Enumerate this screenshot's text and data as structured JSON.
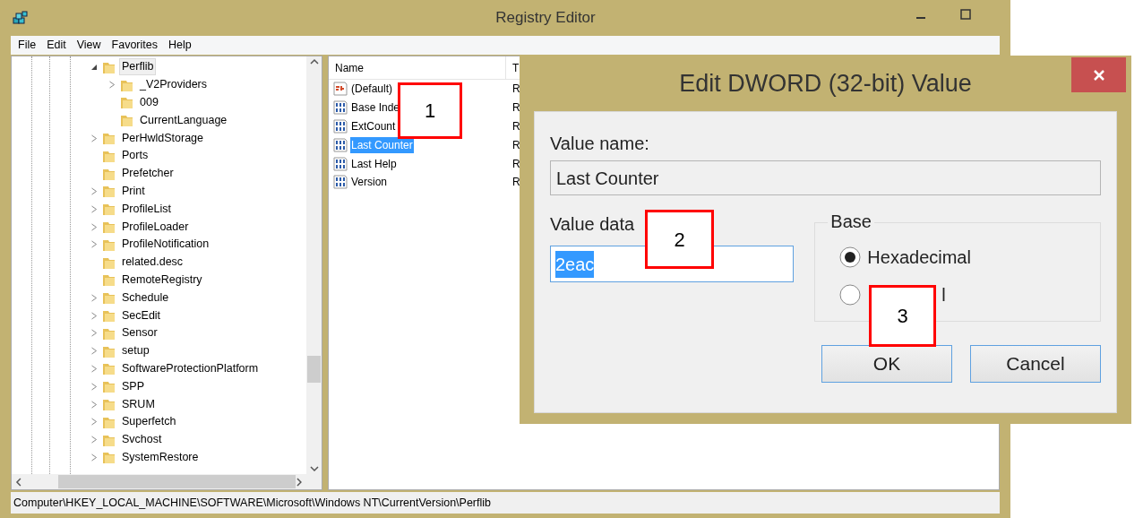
{
  "window": {
    "title": "Registry Editor"
  },
  "menu": [
    "File",
    "Edit",
    "View",
    "Favorites",
    "Help"
  ],
  "tree": {
    "items": [
      {
        "label": "Perflib",
        "kind": "branch",
        "expanded": true,
        "selected": true,
        "children": [
          {
            "label": "_V2Providers",
            "kind": "branch",
            "expanded": false,
            "selected": false
          },
          {
            "label": "009",
            "kind": "leaf",
            "selected": false
          },
          {
            "label": "CurrentLanguage",
            "kind": "leaf",
            "selected": false
          }
        ]
      },
      {
        "label": "PerHwldStorage",
        "kind": "branch",
        "expanded": false,
        "selected": false
      },
      {
        "label": "Ports",
        "kind": "leaf",
        "selected": false
      },
      {
        "label": "Prefetcher",
        "kind": "leaf",
        "selected": false
      },
      {
        "label": "Print",
        "kind": "branch",
        "expanded": false,
        "selected": false
      },
      {
        "label": "ProfileList",
        "kind": "branch",
        "expanded": false,
        "selected": false
      },
      {
        "label": "ProfileLoader",
        "kind": "branch",
        "expanded": false,
        "selected": false
      },
      {
        "label": "ProfileNotification",
        "kind": "branch",
        "expanded": false,
        "selected": false
      },
      {
        "label": "related.desc",
        "kind": "leaf",
        "selected": false
      },
      {
        "label": "RemoteRegistry",
        "kind": "leaf",
        "selected": false
      },
      {
        "label": "Schedule",
        "kind": "branch",
        "expanded": false,
        "selected": false
      },
      {
        "label": "SecEdit",
        "kind": "branch",
        "expanded": false,
        "selected": false
      },
      {
        "label": "Sensor",
        "kind": "branch",
        "expanded": false,
        "selected": false
      },
      {
        "label": "setup",
        "kind": "branch",
        "expanded": false,
        "selected": false
      },
      {
        "label": "SoftwareProtectionPlatform",
        "kind": "branch",
        "expanded": false,
        "selected": false
      },
      {
        "label": "SPP",
        "kind": "branch",
        "expanded": false,
        "selected": false
      },
      {
        "label": "SRUM",
        "kind": "branch",
        "expanded": false,
        "selected": false
      },
      {
        "label": "Superfetch",
        "kind": "branch",
        "expanded": false,
        "selected": false
      },
      {
        "label": "Svchost",
        "kind": "branch",
        "expanded": false,
        "selected": false
      },
      {
        "label": "SystemRestore",
        "kind": "branch",
        "expanded": false,
        "selected": false
      }
    ]
  },
  "values": {
    "columns": [
      "Name",
      "T"
    ],
    "rows": [
      {
        "name": "(Default)",
        "column_2": "R",
        "kind": "string",
        "selected": false
      },
      {
        "name": "Base Inde",
        "column_2": "R",
        "kind": "dword",
        "selected": false
      },
      {
        "name": "ExtCount",
        "column_2": "R",
        "kind": "dword",
        "selected": false
      },
      {
        "name": "Last Counter",
        "column_2": "R",
        "kind": "dword",
        "selected": true
      },
      {
        "name": "Last Help",
        "column_2": "R",
        "kind": "dword",
        "selected": false
      },
      {
        "name": "Version",
        "column_2": "R",
        "kind": "dword",
        "selected": false
      }
    ]
  },
  "status_bar": "Computer\\HKEY_LOCAL_MACHINE\\SOFTWARE\\Microsoft\\Windows NT\\CurrentVersion\\Perflib",
  "dialog": {
    "title": "Edit DWORD (32-bit) Value",
    "value_name_label": "Value name:",
    "value_name": "Last Counter",
    "value_data_label": "Value data",
    "value_data": "2eac",
    "value_data_selected": true,
    "base_label": "Base",
    "base_options": [
      {
        "label": "Hexadecimal",
        "selected": true
      },
      {
        "label": "l",
        "selected": false
      }
    ],
    "buttons": [
      "OK",
      "Cancel"
    ]
  },
  "annotations": [
    "1",
    "2",
    "3"
  ]
}
